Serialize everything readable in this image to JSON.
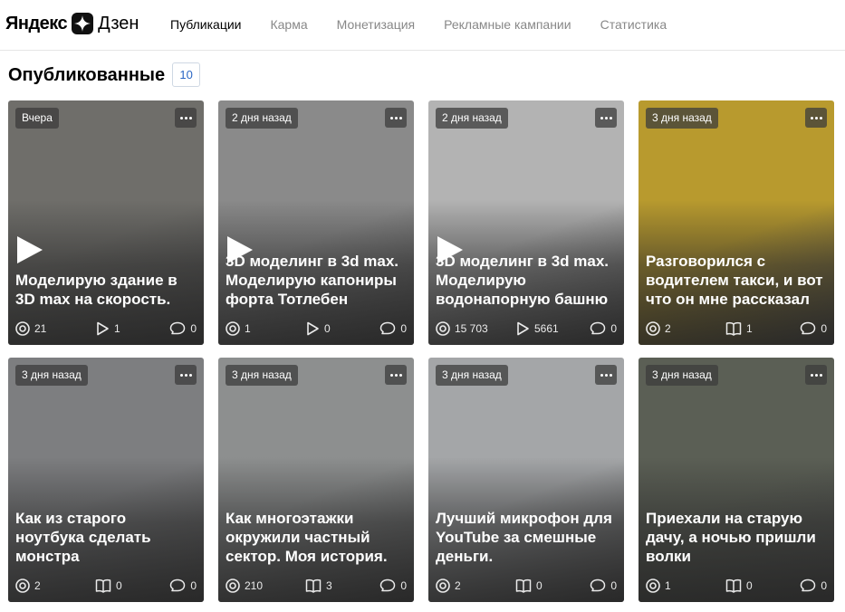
{
  "header": {
    "logo_part1": "Яндекс",
    "logo_part2": "Дзен",
    "nav": [
      {
        "label": "Публикации",
        "active": true
      },
      {
        "label": "Карма",
        "active": false
      },
      {
        "label": "Монетизация",
        "active": false
      },
      {
        "label": "Рекламные кампании",
        "active": false
      },
      {
        "label": "Статистика",
        "active": false
      }
    ]
  },
  "section": {
    "title": "Опубликованные",
    "count": "10"
  },
  "cards": [
    {
      "date": "Вчера",
      "title": "Моделирую здание в 3D max на скорость.",
      "video": true,
      "views": "21",
      "mid_type": "plays",
      "mid": "1",
      "comments": "0",
      "bg": "#6f6e6a"
    },
    {
      "date": "2 дня назад",
      "title": "3D моделинг в 3d max. Моделирую капониры форта Тотлебен",
      "video": true,
      "views": "1",
      "mid_type": "plays",
      "mid": "0",
      "comments": "0",
      "bg": "#8a8a8a"
    },
    {
      "date": "2 дня назад",
      "title": "3D моделинг в 3d max. Моделирую водонапорную башню",
      "video": true,
      "views": "15 703",
      "mid_type": "plays",
      "mid": "5661",
      "comments": "0",
      "bg": "#b3b3b3"
    },
    {
      "date": "3 дня назад",
      "title": "Разговорился с водителем такси, и вот что он мне рассказал",
      "video": false,
      "views": "2",
      "mid_type": "reads",
      "mid": "1",
      "comments": "0",
      "bg": "#b89a2e"
    },
    {
      "date": "3 дня назад",
      "title": "Как из старого ноутбука сделать монстра",
      "video": false,
      "views": "2",
      "mid_type": "reads",
      "mid": "0",
      "comments": "0",
      "bg": "#7d7e80"
    },
    {
      "date": "3 дня назад",
      "title": "Как многоэтажки окружили частный сектор. Моя история.",
      "video": false,
      "views": "210",
      "mid_type": "reads",
      "mid": "3",
      "comments": "0",
      "bg": "#8d8f8f"
    },
    {
      "date": "3 дня назад",
      "title": "Лучший микрофон для YouTube за смешные деньги.",
      "video": false,
      "views": "2",
      "mid_type": "reads",
      "mid": "0",
      "comments": "0",
      "bg": "#a4a6a8"
    },
    {
      "date": "3 дня назад",
      "title": "Приехали на старую дачу, а ночью пришли волки",
      "video": false,
      "views": "1",
      "mid_type": "reads",
      "mid": "0",
      "comments": "0",
      "bg": "#5b5f55"
    }
  ]
}
